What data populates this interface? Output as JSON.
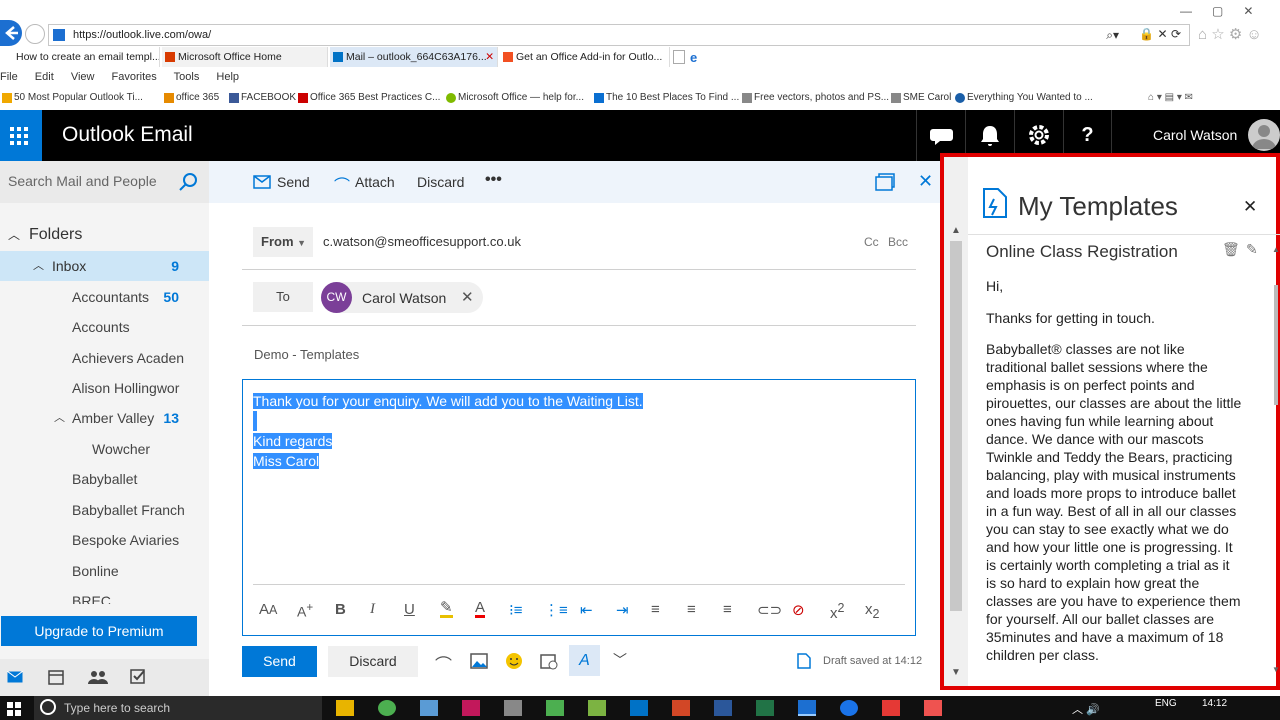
{
  "browser": {
    "url": "https://outlook.live.com/owa/",
    "tabs": [
      {
        "label": "How to create an email templ..."
      },
      {
        "label": "Microsoft Office Home"
      },
      {
        "label": "Mail – outlook_664C63A176..."
      },
      {
        "label": "Get an Office Add-in for Outlo..."
      }
    ],
    "menu": [
      "File",
      "Edit",
      "View",
      "Favorites",
      "Tools",
      "Help"
    ],
    "favorites": [
      "50 Most Popular Outlook Ti...",
      "office 365",
      "FACEBOOK",
      "Office 365 Best Practices  C...",
      "Microsoft Office — help for...",
      "The 10 Best Places To Find ...",
      "Free vectors, photos and PS...",
      "SME Carol",
      "Everything You Wanted to ..."
    ]
  },
  "header": {
    "app_title": "Outlook Email",
    "user_name": "Carol Watson"
  },
  "left": {
    "search_placeholder": "Search Mail and People",
    "folders_label": "Folders",
    "folders": [
      {
        "label": "Inbox",
        "count": "9"
      },
      {
        "label": "Accountants",
        "count": "50"
      },
      {
        "label": "Accounts",
        "count": ""
      },
      {
        "label": "Achievers Acaden",
        "count": ""
      },
      {
        "label": "Alison Hollingwor",
        "count": ""
      },
      {
        "label": "Amber Valley",
        "count": "13"
      },
      {
        "label": "Wowcher",
        "count": ""
      },
      {
        "label": "Babyballet",
        "count": ""
      },
      {
        "label": "Babyballet Franch",
        "count": ""
      },
      {
        "label": "Bespoke Aviaries",
        "count": ""
      },
      {
        "label": "Bonline",
        "count": ""
      },
      {
        "label": "BREC",
        "count": ""
      }
    ],
    "upgrade_label": "Upgrade to Premium"
  },
  "compose": {
    "toolbar": {
      "send": "Send",
      "attach": "Attach",
      "discard": "Discard"
    },
    "from_label": "From",
    "from_value": "c.watson@smeofficesupport.co.uk",
    "cc": "Cc",
    "bcc": "Bcc",
    "to_label": "To",
    "recipient_initials": "CW",
    "recipient_name": "Carol Watson",
    "subject": "Demo - Templates",
    "body_line1": "Thank you for your enquiry.  We will add you to the Waiting List.",
    "body_line2": "Kind regards",
    "body_line3": "Miss Carol",
    "send_button": "Send",
    "discard_button": "Discard",
    "draft_status": "Draft saved at 14:12"
  },
  "templates": {
    "title": "My Templates",
    "template_name": "Online Class Registration",
    "body": [
      "Hi,",
      "Thanks for getting in touch.",
      "Babyballet® classes are not like traditional ballet sessions where the emphasis is on perfect points and pirouettes, our classes are about the little ones having fun while learning about dance.   We dance with our mascots Twinkle and Teddy the Bears, practicing balancing, play with musical instruments and loads more props to introduce ballet in a fun way.  Best of all in all our classes you can stay to see exactly what we do and how your little one is progressing.  It is certainly worth completing a trial as it is so hard to explain how great the classes are you have to experience them for yourself.  All our ballet classes are 35minutes and have a maximum of 18 children per class."
    ]
  },
  "taskbar": {
    "search_placeholder": "Type here to search",
    "language": "ENG",
    "time": "14:12"
  },
  "colors": {
    "accent": "#0078d7",
    "highlight_border": "#e00000",
    "avatar": "#7b3f98"
  }
}
